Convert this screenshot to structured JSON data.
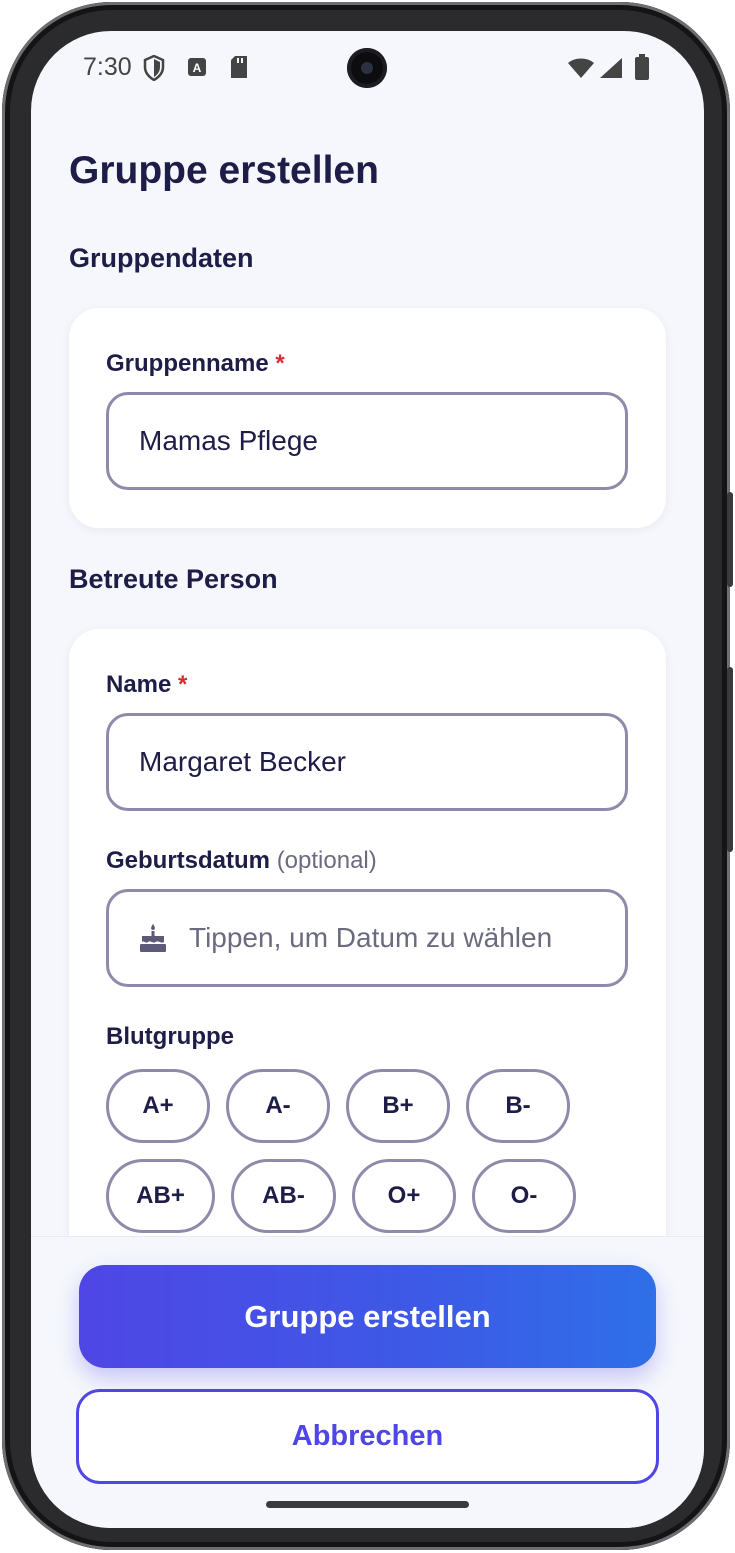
{
  "status_bar": {
    "time": "7:30",
    "icons": [
      "shield-icon",
      "a-notification-icon",
      "sd-card-icon",
      "wifi-icon",
      "signal-icon",
      "battery-icon"
    ]
  },
  "page": {
    "title": "Gruppe erstellen"
  },
  "group_section": {
    "heading": "Gruppendaten",
    "group_name_label": "Gruppenname",
    "required_marker": "*",
    "group_name_value": "Mamas Pflege"
  },
  "person_section": {
    "heading": "Betreute Person",
    "name_label": "Name",
    "required_marker": "*",
    "name_value": "Margaret Becker",
    "birthdate_label": "Geburtsdatum",
    "birthdate_optional": "(optional)",
    "birthdate_placeholder": "Tippen, um Datum zu wählen",
    "blood_label": "Blutgruppe",
    "blood_types": [
      "A+",
      "A-",
      "B+",
      "B-",
      "AB+",
      "AB-",
      "O+",
      "O-"
    ]
  },
  "actions": {
    "create_label": "Gruppe erstellen",
    "cancel_label": "Abbrechen"
  },
  "colors": {
    "primary": "#4f46e5",
    "primary_end": "#2f6fe8",
    "text_dark": "#1e1d47",
    "required": "#d32f2f",
    "background": "#f5f7fc"
  }
}
